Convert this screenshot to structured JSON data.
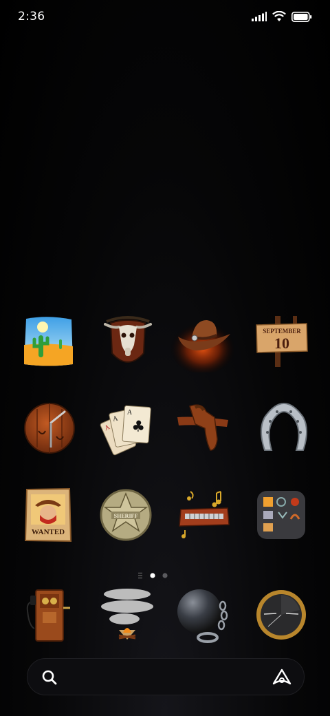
{
  "status_bar": {
    "time": "2:36",
    "icons": [
      "cellular-signal-icon",
      "wifi-icon",
      "battery-icon"
    ]
  },
  "home_grid": {
    "rows": [
      [
        "desert-cactus-icon",
        "bull-skull-plaque-icon",
        "cowboy-hat-icon",
        "calendar-signpost-icon"
      ],
      [
        "wooden-barrel-icon",
        "playing-cards-icon",
        "gun-holster-icon",
        "horseshoe-icon"
      ],
      [
        "wanted-poster-icon",
        "sheriff-badge-icon",
        "harmonica-music-icon",
        "folder-icon"
      ]
    ],
    "calendar": {
      "month": "SEPTEMBER",
      "day": "10"
    },
    "wanted_text": "WANTED",
    "sheriff_text": "SHERIFF"
  },
  "page_indicator": {
    "pages": 2,
    "current": 1
  },
  "dock": [
    "wall-telephone-icon",
    "smoke-signal-icon",
    "ball-and-chain-icon",
    "compass-icon"
  ],
  "search_bar": {
    "icons": [
      "search-icon",
      "assistant-icon"
    ]
  },
  "colors": {
    "background": "#000000",
    "accent_glow": "#c2410c",
    "wood": "#8b4513"
  }
}
